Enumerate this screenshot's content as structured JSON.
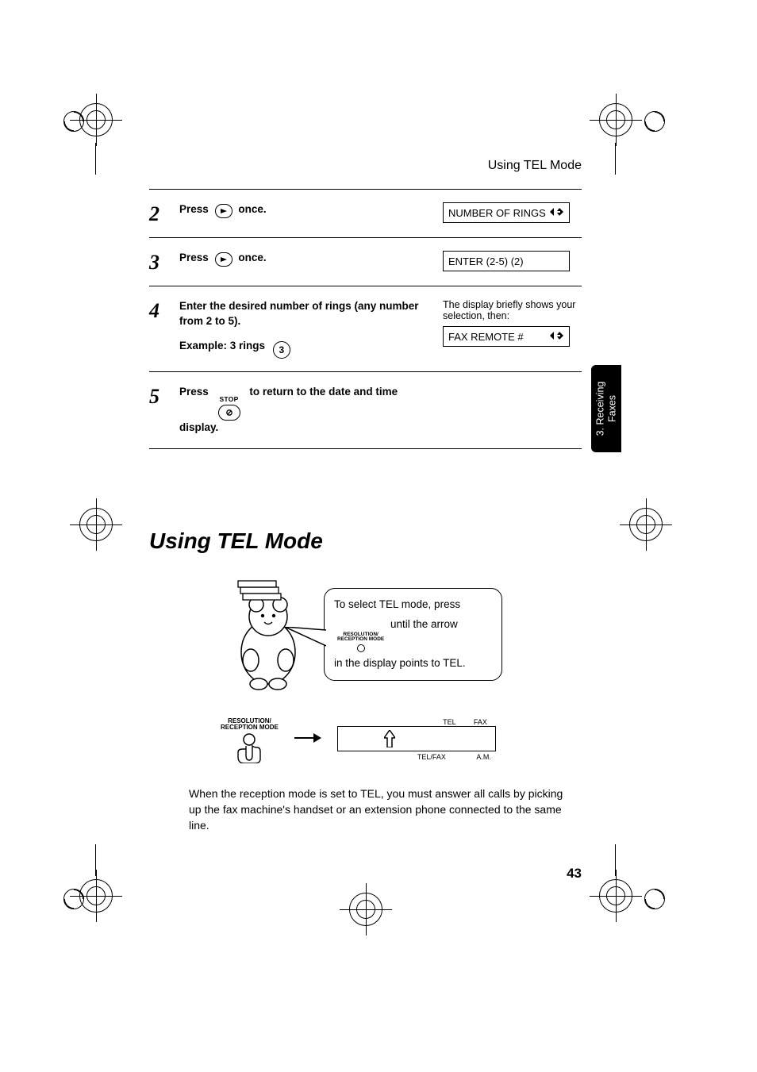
{
  "running_head": "Using TEL Mode",
  "steps": {
    "s2": {
      "num": "2",
      "text_a": "Press",
      "text_b": "once.",
      "lcd": "NUMBER OF RINGS"
    },
    "s3": {
      "num": "3",
      "text_a": "Press",
      "text_b": "once.",
      "lcd": "ENTER (2-5) (2)"
    },
    "s4": {
      "num": "4",
      "text_a": "Enter the desired number of rings (any number from 2 to 5).",
      "example_label": "Example: 3 rings",
      "example_key": "3",
      "note": "The display briefly shows your selection, then:",
      "lcd": "FAX REMOTE #"
    },
    "s5": {
      "num": "5",
      "text_a": "Press",
      "stop_label": "STOP",
      "text_b": "to return to the date and time display."
    }
  },
  "side_tab": {
    "line1": "3. Receiving",
    "line2": "Faxes"
  },
  "section_title": "Using TEL Mode",
  "bubble": {
    "line1": "To select TEL mode, press",
    "res_label_1": "RESOLUTION/",
    "res_label_2": "RECEPTION MODE",
    "line2_tail": "until the arrow",
    "line3": "in the display points to TEL."
  },
  "mode_diagram": {
    "res_label_1": "RESOLUTION/",
    "res_label_2": "RECEPTION MODE",
    "top_labels": {
      "tel": "TEL",
      "fax": "FAX"
    },
    "bottom_labels": {
      "telfax": "TEL/FAX",
      "am": "A.M."
    }
  },
  "body_text": "When the reception mode is set to TEL, you must answer all calls by picking up the fax machine's handset or an extension phone connected to the same line.",
  "page_number": "43"
}
